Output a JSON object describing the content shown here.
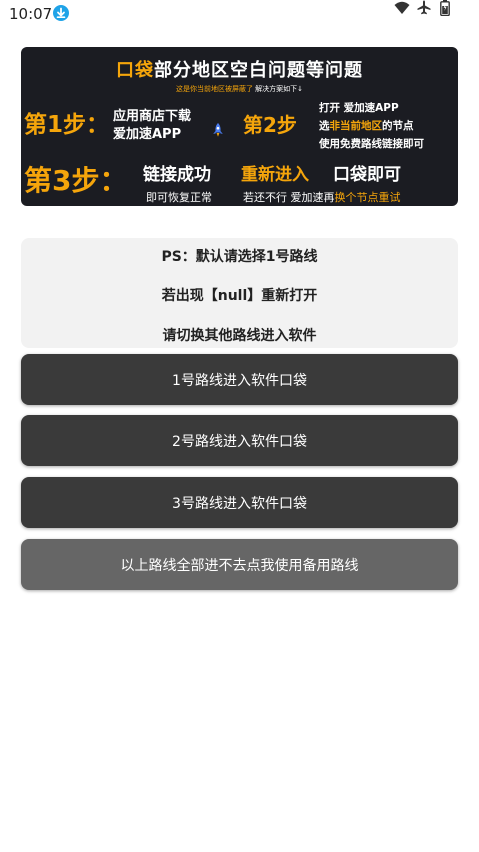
{
  "status_bar": {
    "time": "10:07",
    "icons": [
      "download-icon",
      "wifi-icon",
      "airplane-icon",
      "battery-icon"
    ]
  },
  "banner": {
    "title_highlight": "口袋",
    "title_rest": "部分地区空白问题等问题",
    "subtitle_highlight": "这是你当前地区被屏蔽了",
    "subtitle_rest": " 解决方案如下↓",
    "step1_label": "第1步：",
    "step1_line1": "应用商店下载",
    "step1_line2": "爱加速APP",
    "step2_label": "第2步",
    "step2_line1": "打开  爱加速APP",
    "step2_line2_pre": "选",
    "step2_line2_highlight": "非当前地区",
    "step2_line2_post": "的节点",
    "step2_line3": "使用免费路线链接即可",
    "step3_label": "第3步：",
    "step3_part1": "链接成功",
    "step3_part2": "重新进入",
    "step3_part3": "口袋即可",
    "step3_note1": "即可恢复正常",
    "step3_note2_pre": "若还不行 爱加速再",
    "step3_note2_highlight": "换个节点重试"
  },
  "info": {
    "line1": "PS：默认请选择1号路线",
    "line2": "若出现【null】重新打开",
    "line3": "请切换其他路线进入软件"
  },
  "buttons": {
    "route1": "1号路线进入软件口袋",
    "route2": "2号路线进入软件口袋",
    "route3": "3号路线进入软件口袋",
    "backup": "以上路线全部进不去点我使用备用路线"
  },
  "colors": {
    "accent": "#f5a50b",
    "banner_bg": "#1b1c22",
    "button_dark": "#3a3a3a",
    "button_backup": "#666666",
    "info_bg": "#f2f2f2"
  }
}
